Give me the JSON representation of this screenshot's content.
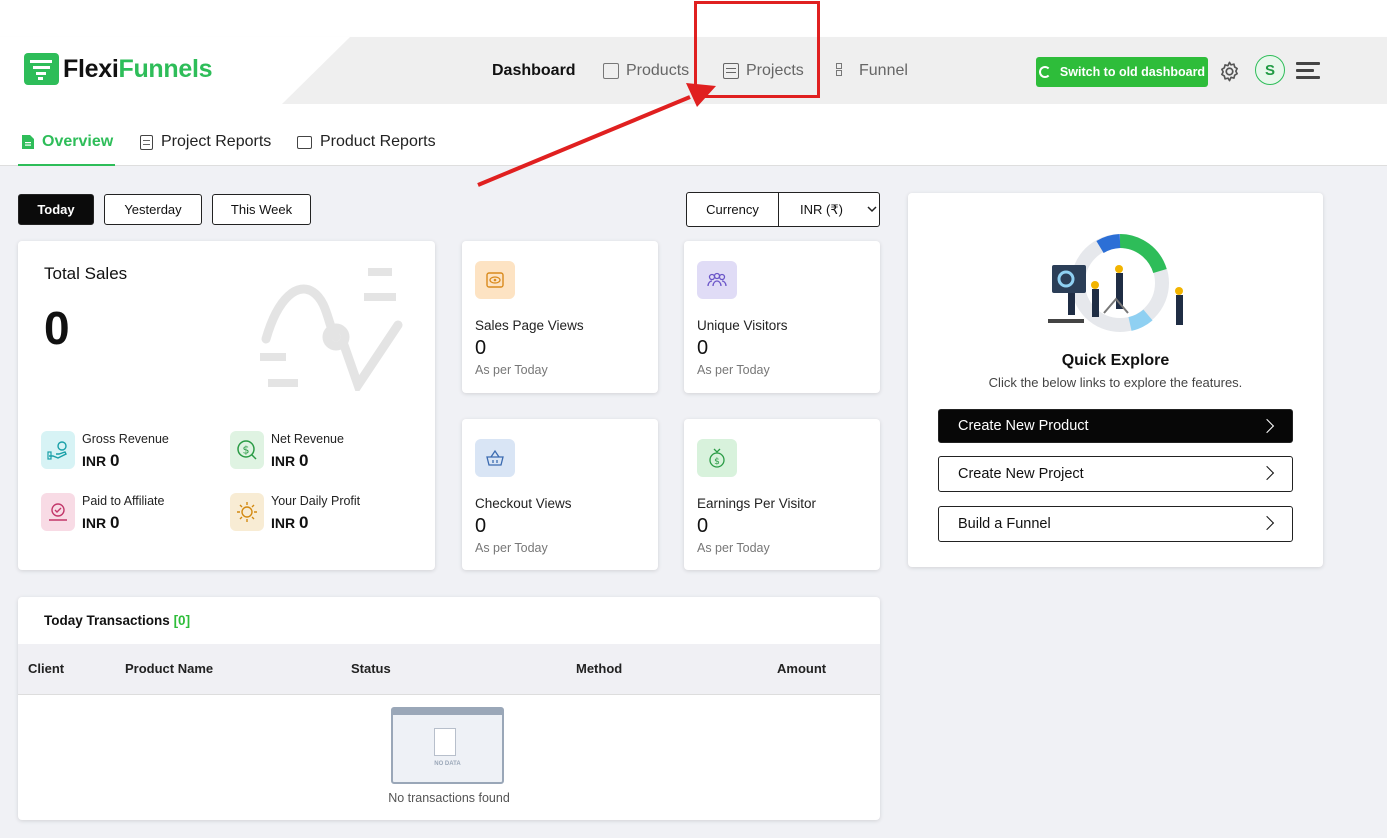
{
  "brand": {
    "name_part1": "Flexi",
    "name_part2": "Funnels",
    "accent": "#2ebd59"
  },
  "nav": {
    "dashboard": "Dashboard",
    "products": "Products",
    "projects": "Projects",
    "funnel": "Funnel"
  },
  "header": {
    "switch_label": "Switch to old dashboard",
    "avatar_initial": "S"
  },
  "subtabs": {
    "overview": "Overview",
    "project_reports": "Project Reports",
    "product_reports": "Product Reports"
  },
  "filters": {
    "today": "Today",
    "yesterday": "Yesterday",
    "this_week": "This Week"
  },
  "currency": {
    "label": "Currency",
    "value": "INR (₹)"
  },
  "total_sales": {
    "title": "Total Sales",
    "value": "0",
    "gross_revenue": {
      "label": "Gross Revenue",
      "currency": "INR",
      "value": "0"
    },
    "net_revenue": {
      "label": "Net Revenue",
      "currency": "INR",
      "value": "0"
    },
    "paid_to_affiliate": {
      "label": "Paid to Affiliate",
      "currency": "INR",
      "value": "0"
    },
    "daily_profit": {
      "label": "Your Daily Profit",
      "currency": "INR",
      "value": "0"
    }
  },
  "stats": {
    "sales_page_views": {
      "label": "Sales Page Views",
      "value": "0",
      "sub": "As per Today"
    },
    "unique_visitors": {
      "label": "Unique Visitors",
      "value": "0",
      "sub": "As per Today"
    },
    "checkout_views": {
      "label": "Checkout Views",
      "value": "0",
      "sub": "As per Today"
    },
    "earnings_per_visitor": {
      "label": "Earnings Per Visitor",
      "value": "0",
      "sub": "As per Today"
    }
  },
  "quick_explore": {
    "title": "Quick Explore",
    "subtitle": "Click the below links to explore the features.",
    "create_product": "Create New Product",
    "create_project": "Create New Project",
    "build_funnel": "Build a Funnel"
  },
  "transactions": {
    "title": "Today Transactions",
    "count": "[0]",
    "columns": {
      "client": "Client",
      "product_name": "Product Name",
      "status": "Status",
      "method": "Method",
      "amount": "Amount"
    },
    "empty_art_text": "NO DATA",
    "empty_text": "No transactions found"
  },
  "colors": {
    "annotation": "#e02020",
    "switch_green": "#2ebd3a"
  }
}
